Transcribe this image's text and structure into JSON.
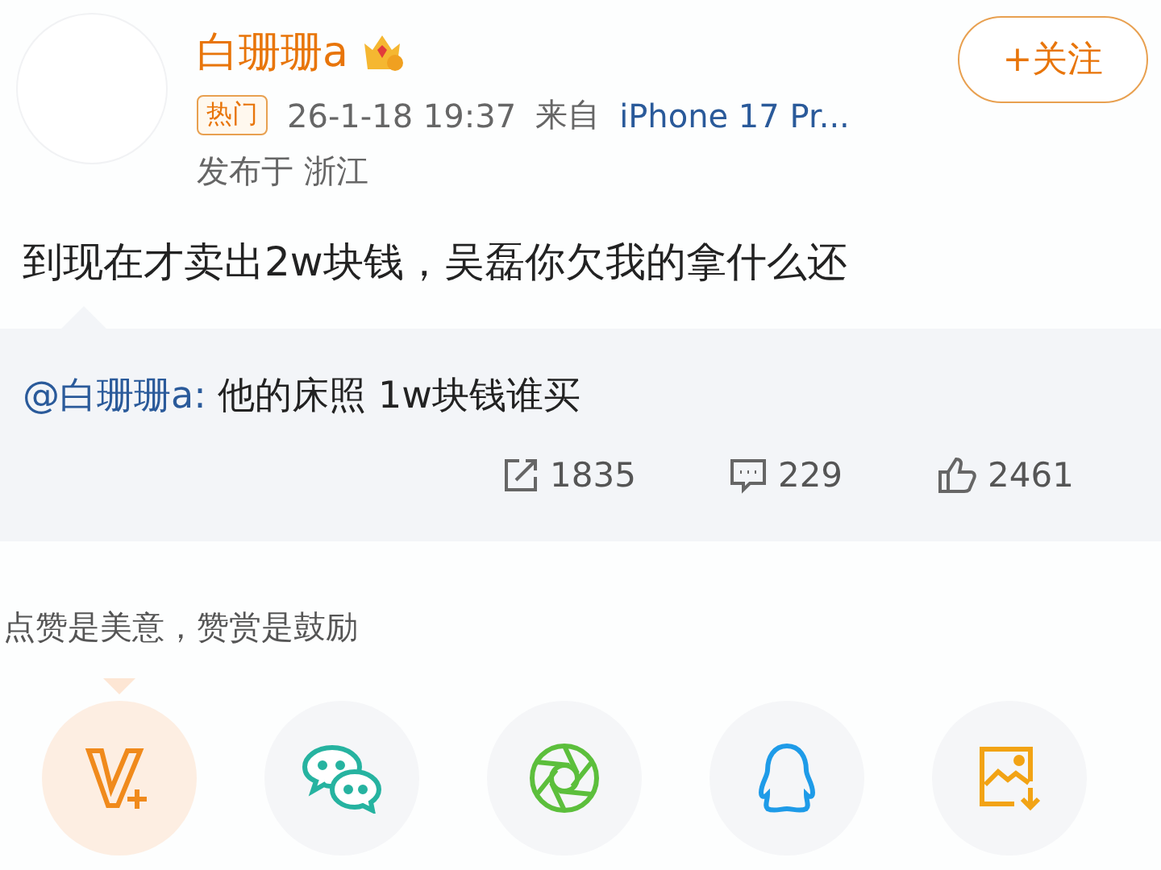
{
  "author": {
    "name": "白珊珊a",
    "follow_button": "+关注"
  },
  "meta": {
    "tag": "热门",
    "time": "26-1-18 19:37",
    "source_prefix": "来自",
    "source": "iPhone 17 Pr...",
    "location": "发布于 浙江"
  },
  "post": {
    "text": "到现在才卖出2w块钱，吴磊你欠我的拿什么还"
  },
  "quote": {
    "mention": "@白珊珊a:",
    "text": "他的床照 1w块钱谁买"
  },
  "stats": [
    {
      "kind": "repost",
      "count": "1835"
    },
    {
      "kind": "comment",
      "count": "229"
    },
    {
      "kind": "like",
      "count": "2461"
    }
  ],
  "reward_hint": "点赞是美意，赞赏是鼓励",
  "share_actions": [
    {
      "kind": "reward",
      "selected": true
    },
    {
      "kind": "wechat",
      "selected": false
    },
    {
      "kind": "moments",
      "selected": false
    },
    {
      "kind": "qq",
      "selected": false
    },
    {
      "kind": "save_image",
      "selected": false
    }
  ]
}
